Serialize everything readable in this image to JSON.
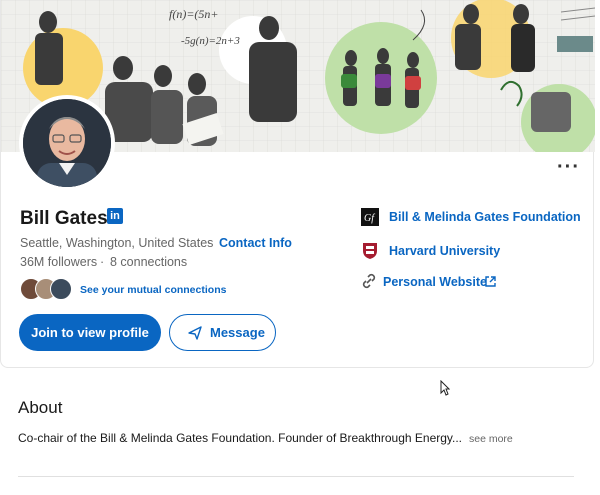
{
  "profile": {
    "name": "Bill Gates",
    "linkedin_badge": "in",
    "location": "Seattle, Washington, United States",
    "separator": "·",
    "contact_info_label": "Contact Info",
    "followers": "36M followers",
    "connections": "8 connections",
    "mutual_connections_label": "See your mutual connections",
    "more_icon": "···"
  },
  "actions": {
    "join_label": "Join to view profile",
    "message_label": "Message"
  },
  "affiliations": [
    {
      "label": "Bill & Melinda Gates Foundation",
      "icon": "gates-foundation-logo"
    },
    {
      "label": "Harvard University",
      "icon": "harvard-shield-logo"
    },
    {
      "label": "Personal Website",
      "icon": "link-icon"
    }
  ],
  "about": {
    "title": "About",
    "text": "Co-chair of the Bill & Melinda Gates Foundation. Founder of Breakthrough Energy...",
    "see_more": "see more"
  },
  "colors": {
    "brand_blue": "#0a66c2",
    "cover_green": "#bfe0a8",
    "cover_yellow": "#f9d56e"
  }
}
